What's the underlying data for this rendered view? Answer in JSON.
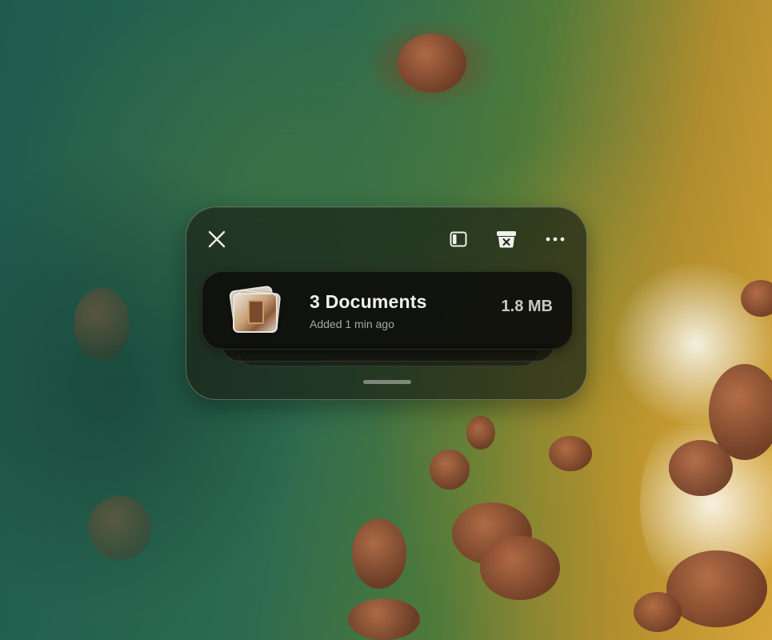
{
  "widget": {
    "toolbar": {
      "close_icon": "close-icon",
      "sidebar_icon": "sidebar-icon",
      "clear_icon": "clear-tray-icon",
      "more_icon": "ellipsis-icon"
    },
    "item": {
      "title": "3 Documents",
      "subtitle": "Added 1 min ago",
      "size": "1.8 MB",
      "thumbnail_icon": "documents-stack-icon"
    }
  },
  "colors": {
    "widget_bg": "#1c2216",
    "card_bg": "#0e0e0a",
    "title_text": "#f2f2f0",
    "muted_text": "#a9a9a4"
  }
}
